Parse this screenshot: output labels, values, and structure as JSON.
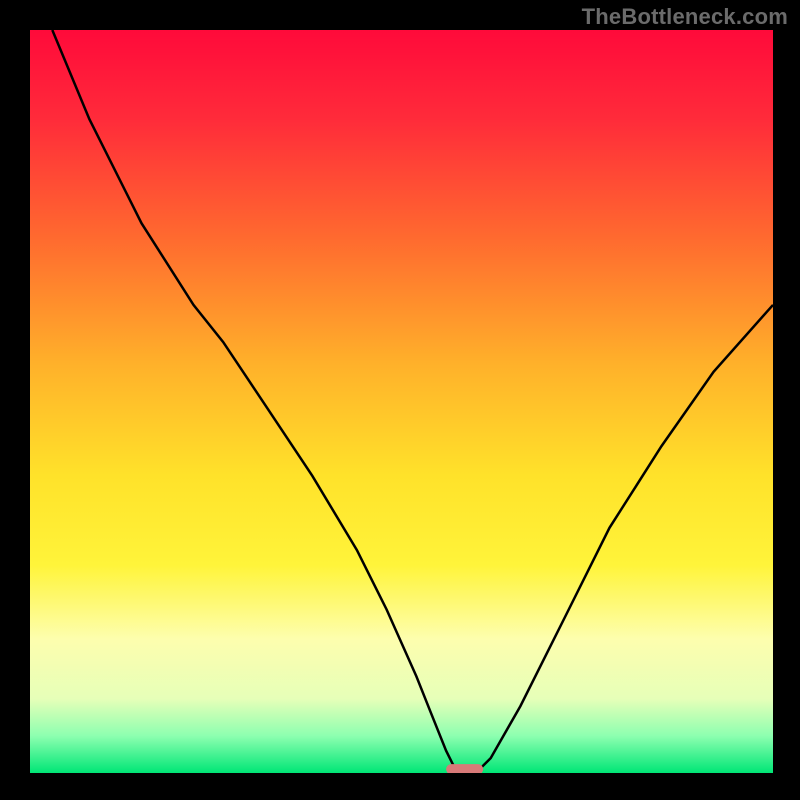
{
  "attribution": "TheBottleneck.com",
  "chart_data": {
    "type": "line",
    "title": "",
    "xlabel": "",
    "ylabel": "",
    "xlim": [
      0,
      100
    ],
    "ylim": [
      0,
      100
    ],
    "background_gradient": {
      "stops": [
        {
          "offset": 0.0,
          "color": "#ff0a3a"
        },
        {
          "offset": 0.12,
          "color": "#ff2b3a"
        },
        {
          "offset": 0.28,
          "color": "#ff6a2f"
        },
        {
          "offset": 0.45,
          "color": "#ffb12a"
        },
        {
          "offset": 0.6,
          "color": "#ffe22a"
        },
        {
          "offset": 0.72,
          "color": "#fff43a"
        },
        {
          "offset": 0.82,
          "color": "#fdfeae"
        },
        {
          "offset": 0.9,
          "color": "#e6ffb8"
        },
        {
          "offset": 0.95,
          "color": "#8dffb0"
        },
        {
          "offset": 1.0,
          "color": "#00e676"
        }
      ]
    },
    "series": [
      {
        "name": "bottleneck-curve",
        "color": "#000000",
        "stroke_width": 2.5,
        "x": [
          3,
          8,
          15,
          22,
          26,
          32,
          38,
          44,
          48,
          52,
          54,
          56,
          57,
          59,
          60,
          62,
          66,
          72,
          78,
          85,
          92,
          100
        ],
        "y": [
          100,
          88,
          74,
          63,
          58,
          49,
          40,
          30,
          22,
          13,
          8,
          3,
          1,
          0,
          0,
          2,
          9,
          21,
          33,
          44,
          54,
          63
        ]
      }
    ],
    "marker": {
      "name": "optimal-range-marker",
      "color": "#d77a78",
      "x_center": 58.5,
      "y": 0.5,
      "width": 5,
      "height": 1.4,
      "rx": 0.7
    }
  }
}
